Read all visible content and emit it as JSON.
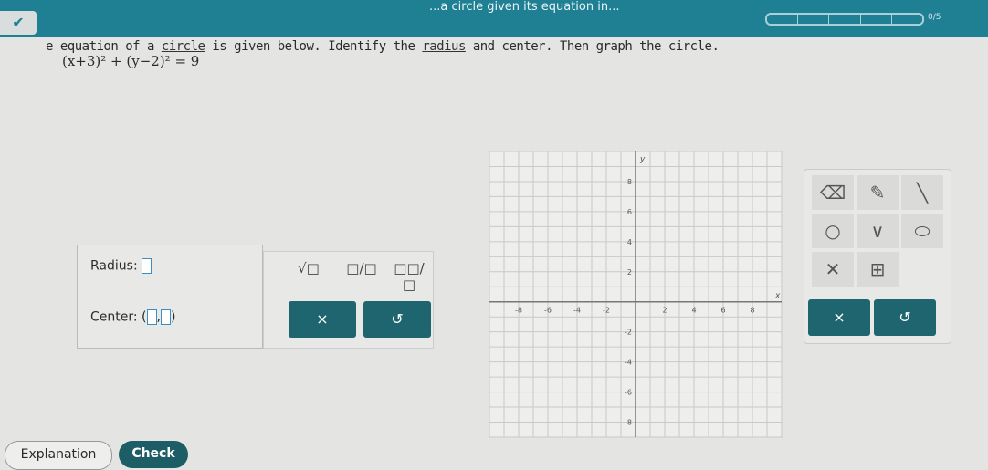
{
  "header": {
    "title": "...a circle given its equation in...",
    "progress": "0/5",
    "progress_segments": 5,
    "progress_fraction": 0
  },
  "question": {
    "text_pre": "e equation of a ",
    "link1": "circle",
    "text_mid": " is given below. Identify the ",
    "link2": "radius",
    "text_post": " and center. Then graph the circle.",
    "equation": "(x+3)² + (y−2)² = 9"
  },
  "answer": {
    "radius_label": "Radius:",
    "center_label": "Center:",
    "open_paren": "(",
    "comma": ",",
    "close_paren": ")"
  },
  "math_buttons": {
    "sqrt": "√□",
    "fraction": "□/□",
    "mixed": "□□/□",
    "clear": "×",
    "undo": "↺"
  },
  "graph": {
    "x_label": "x",
    "y_label": "y",
    "xlim": [
      -10,
      10
    ],
    "ylim": [
      -9,
      10
    ],
    "x_ticks": [
      -8,
      -6,
      -4,
      -2,
      2,
      4,
      6,
      8
    ],
    "y_ticks": [
      -8,
      -6,
      -4,
      -2,
      2,
      4,
      6,
      8
    ]
  },
  "tools": {
    "items": [
      "eraser-icon",
      "pencil-icon",
      "line-segment-icon",
      "circle-icon",
      "parabola-icon",
      "ellipse-icon",
      "hyperbola-icon",
      "table-icon"
    ],
    "clear": "×",
    "undo": "↺"
  },
  "footer": {
    "explanation": "Explanation",
    "check": "Check"
  }
}
